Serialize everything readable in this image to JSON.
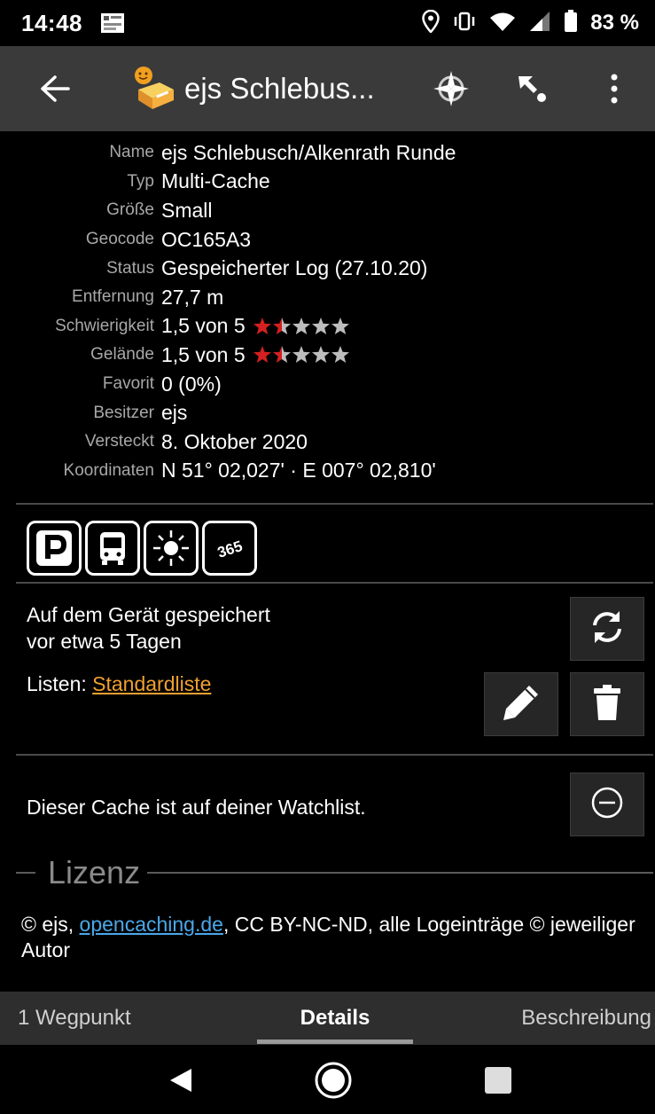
{
  "status_bar": {
    "time": "14:48",
    "battery_percent": "83 %",
    "icons": [
      "notification-image-icon",
      "location-icon",
      "vibrate-icon",
      "wifi-icon",
      "signal-icon",
      "battery-icon"
    ]
  },
  "action_bar": {
    "title": "ejs Schlebus...",
    "icons": [
      "back-arrow-icon",
      "cache-type-icon",
      "compass-icon",
      "navigate-icon",
      "overflow-menu-icon"
    ]
  },
  "details": [
    {
      "label": "Name",
      "value": "ejs Schlebusch/Alkenrath Runde"
    },
    {
      "label": "Typ",
      "value": "Multi-Cache"
    },
    {
      "label": "Größe",
      "value": "Small"
    },
    {
      "label": "Geocode",
      "value": "OC165A3"
    },
    {
      "label": "Status",
      "value": "Gespeicherter Log (27.10.20)"
    },
    {
      "label": "Entfernung",
      "value": "27,7 m"
    },
    {
      "label": "Schwierigkeit",
      "value": "1,5 von 5",
      "rating": 1.5
    },
    {
      "label": "Gelände",
      "value": "1,5 von 5",
      "rating": 1.5
    },
    {
      "label": "Favorit",
      "value": "0 (0%)"
    },
    {
      "label": "Besitzer",
      "value": "ejs"
    },
    {
      "label": "Versteckt",
      "value": "8. Oktober 2020"
    },
    {
      "label": "Koordinaten",
      "value": "N 51° 02,027' · E 007° 02,810'"
    }
  ],
  "attributes": [
    "parking-icon",
    "bus-icon",
    "sun-icon",
    "365-days-icon"
  ],
  "attribute_365_text": "365",
  "stored": {
    "line1": "Auf dem Gerät gespeichert",
    "line2": "vor etwa 5 Tagen",
    "lists_label": "Listen: ",
    "lists_link": "Standardliste"
  },
  "watchlist": {
    "text": "Dieser Cache ist auf deiner Watchlist."
  },
  "license": {
    "title": "Lizenz",
    "prefix": "© ejs, ",
    "link": "opencaching.de",
    "suffix": ", CC BY-NC-ND, alle Logeinträge © jeweiliger Autor"
  },
  "tabs": {
    "left": "1 Wegpunkt",
    "center": "Details",
    "right": "Beschreibung",
    "selected": "Details"
  },
  "colors": {
    "star_filled": "#d42020",
    "star_empty": "#bdbdbd",
    "link_orange": "#f0a030",
    "link_blue": "#4aa8e8",
    "action_bar_bg": "#3a3a3a"
  }
}
